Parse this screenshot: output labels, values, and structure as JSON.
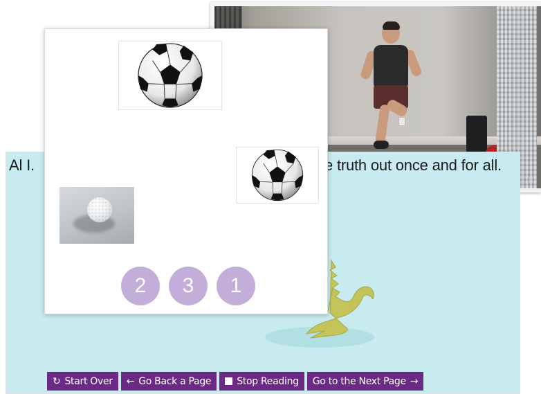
{
  "story": {
    "text_left": "Al I.",
    "text_right": "e truth out once and for all."
  },
  "quiz": {
    "images": [
      {
        "name": "soccer-ball",
        "alt": "soccer ball"
      },
      {
        "name": "soccer-ball",
        "alt": "soccer ball"
      },
      {
        "name": "golf-ball",
        "alt": "golf ball"
      }
    ],
    "numbers": [
      "2",
      "3",
      "1"
    ],
    "number_color": "#c3aed9"
  },
  "controls": {
    "start_over": {
      "label": "Start Over",
      "icon": "refresh-icon"
    },
    "go_back": {
      "label": "Go Back a Page",
      "icon": "arrow-left-icon"
    },
    "stop_reading": {
      "label": "Stop Reading",
      "icon": "stop-icon"
    },
    "next_page": {
      "label": "Go to the Next Page",
      "icon": "arrow-right-icon"
    }
  },
  "colors": {
    "page_background": "#c7ebef",
    "button_background": "#6b2a86",
    "highlight": "#e7c12f",
    "crocodile": "#c4c45b"
  },
  "video": {
    "controls_text": "▫ ⁞"
  }
}
